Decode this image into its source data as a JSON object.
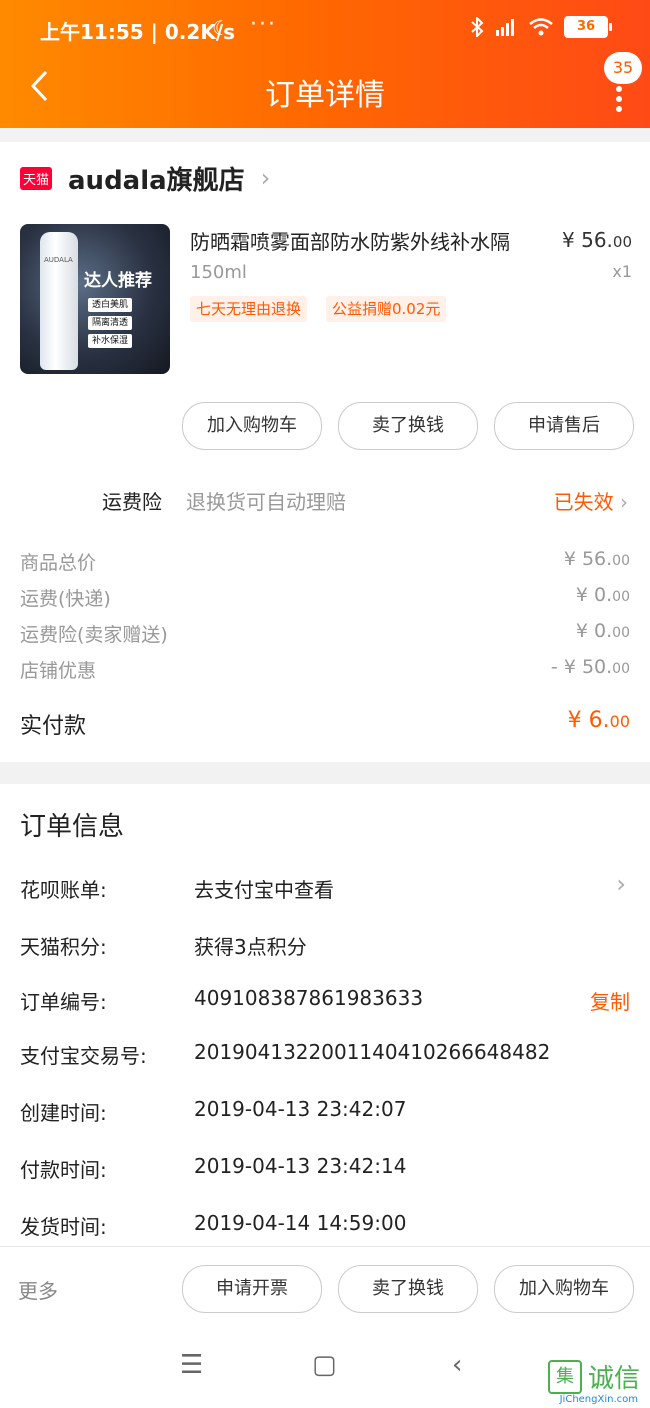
{
  "status": {
    "time": "上午11:55 | 0.2K/s",
    "battery": "36"
  },
  "nav": {
    "title": "订单详情",
    "badge": "35"
  },
  "shop": {
    "badge": "天猫",
    "name": "audala旗舰店"
  },
  "product": {
    "title": "防晒霜喷雾面部防水防紫外线补水隔",
    "spec": "150ml",
    "price_main": "¥ 56.",
    "price_dec": "00",
    "qty": "x1",
    "tags": [
      "七天无理由退换",
      "公益捐赠0.02元"
    ],
    "image_title": "达人推荐",
    "image_lines": [
      "透白美肌",
      "隔离清透",
      "补水保湿"
    ],
    "image_brand": "AUDALA"
  },
  "product_actions": [
    "加入购物车",
    "卖了换钱",
    "申请售后"
  ],
  "insurance": {
    "label": "运费险",
    "desc": "退换货可自动理赔",
    "status": "已失效"
  },
  "fees": [
    {
      "label": "商品总价",
      "main": "¥ 56.",
      "dec": "00"
    },
    {
      "label": "运费(快递)",
      "main": "¥ 0.",
      "dec": "00"
    },
    {
      "label": "运费险(卖家赠送)",
      "main": "¥ 0.",
      "dec": "00"
    },
    {
      "label": "店铺优惠",
      "main": "- ¥ 50.",
      "dec": "00"
    }
  ],
  "paid": {
    "label": "实付款",
    "main": "¥ 6.",
    "dec": "00"
  },
  "order_info": {
    "title": "订单信息",
    "rows": [
      {
        "label": "花呗账单:",
        "value": "去支付宝中查看"
      },
      {
        "label": "天猫积分:",
        "value": "获得3点积分"
      },
      {
        "label": "订单编号:",
        "value": "409108387861983633",
        "action": "复制"
      },
      {
        "label": "支付宝交易号:",
        "value": "2019041322001140410266648482"
      },
      {
        "label": "创建时间:",
        "value": "2019-04-13 23:42:07"
      },
      {
        "label": "付款时间:",
        "value": "2019-04-13 23:42:14"
      },
      {
        "label": "发货时间:",
        "value": "2019-04-14 14:59:00"
      }
    ]
  },
  "bottom": {
    "more": "更多",
    "buttons": [
      "申请开票",
      "卖了换钱",
      "加入购物车"
    ]
  },
  "watermark": {
    "char": "集",
    "text": "诚信",
    "sub": "JiChengXin.com"
  }
}
